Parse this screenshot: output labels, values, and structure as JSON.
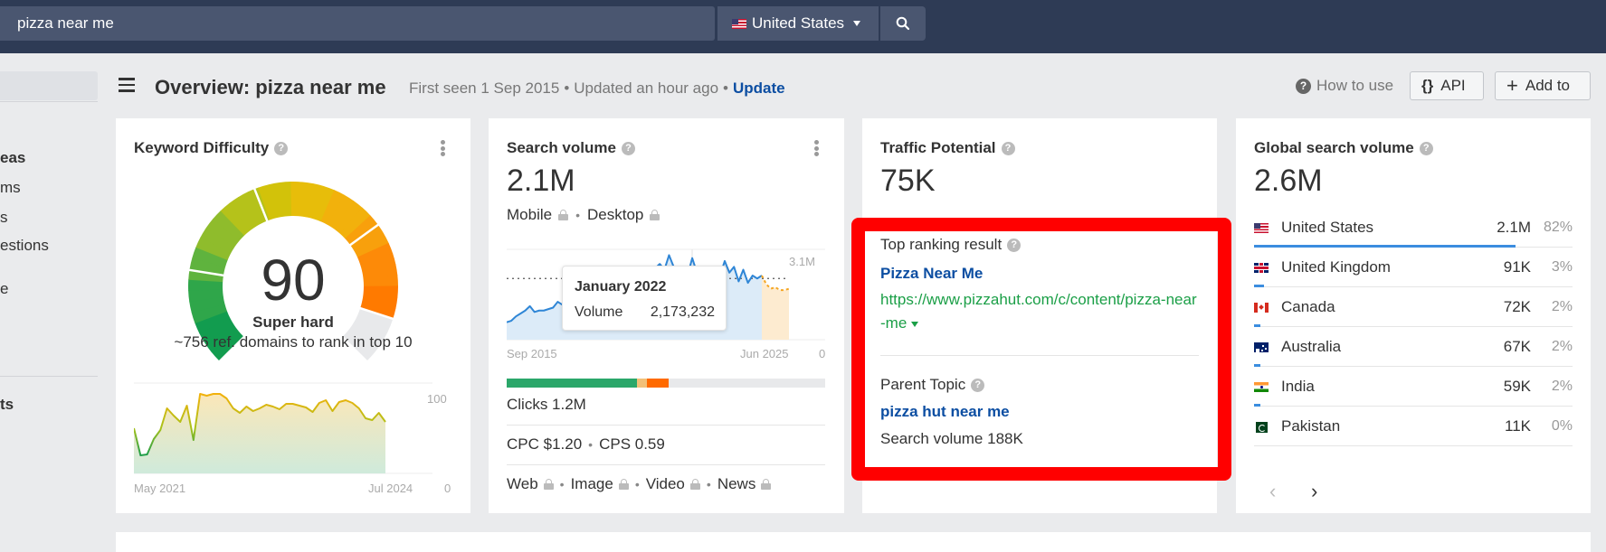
{
  "header": {
    "search_value": "pizza near me",
    "country": "United States",
    "country_flag": "us-flag-icon",
    "search_icon": "search-icon"
  },
  "sidebar": {
    "items": [
      {
        "label": "eas",
        "bold": true
      },
      {
        "label": "ms",
        "bold": false
      },
      {
        "label": "s",
        "bold": false
      },
      {
        "label": "estions",
        "bold": false
      },
      {
        "label": "e",
        "bold": false
      },
      {
        "label": "ts",
        "bold": true
      }
    ]
  },
  "title_row": {
    "title": "Overview: pizza near me",
    "first_seen": "First seen 1 Sep 2015",
    "updated": "Updated an hour ago",
    "update_link": "Update",
    "separator": "•",
    "how_to_use": "How to use",
    "api_label": "API",
    "add_to_label": "Add to"
  },
  "keyword_difficulty": {
    "title": "Keyword Difficulty",
    "score": "90",
    "score_value": 90,
    "label": "Super hard",
    "description": "~756 ref. domains to rank in top 10",
    "chart": {
      "start_label": "May 2021",
      "end_label": "Jul 2024",
      "y_max_label": "100",
      "y_min_label": "0",
      "values": [
        50,
        20,
        21,
        38,
        48,
        72,
        64,
        57,
        75,
        37,
        88,
        86,
        88,
        88,
        83,
        72,
        67,
        74,
        69,
        72,
        76,
        74,
        71,
        77,
        77,
        75,
        73,
        68,
        78,
        81,
        69,
        79,
        81,
        78,
        72,
        61,
        59,
        67,
        57
      ]
    }
  },
  "search_volume": {
    "title": "Search volume",
    "value": "2.1M",
    "mobile_label": "Mobile",
    "desktop_label": "Desktop",
    "chart": {
      "start_label": "Sep 2015",
      "end_label": "Jun 2025",
      "y_max_label": "3.1M",
      "y_min_label": "0",
      "average_line": 2.1,
      "values_millions": [
        0.6,
        0.65,
        0.8,
        0.9,
        1.0,
        1.15,
        0.95,
        1.0,
        1.0,
        1.05,
        1.1,
        1.3,
        1.2,
        1.4,
        1.7,
        1.8,
        1.75,
        1.85,
        1.95,
        1.9,
        2.0,
        1.9,
        2.1,
        2.0,
        2.3,
        2.15,
        2.2,
        2.4,
        2.3,
        2.5,
        2.2,
        2.3,
        2.45,
        2.6,
        2.4,
        2.9,
        2.5,
        2.4,
        2.3,
        2.2,
        2.8,
        2.3,
        2.5,
        2.2,
        2.4,
        2.3,
        2.2,
        2.7,
        2.3,
        2.5,
        2.0,
        2.4,
        1.95,
        2.2,
        2.1,
        2.2
      ],
      "forecast_millions": [
        2.2,
        1.9,
        1.75,
        1.8,
        1.7,
        1.7,
        1.75
      ]
    },
    "tooltip": {
      "title": "January 2022",
      "key": "Volume",
      "value": "2,173,232"
    },
    "clicks_bar": {
      "organic_pct": 41,
      "paid_light_pct": 3,
      "paid_pct": 7,
      "colors": {
        "organic": "#2ba76a",
        "paid_light": "#f2c078",
        "paid": "#ff6a00"
      }
    },
    "clicks": "Clicks 1.2M",
    "cpc": "CPC $1.20",
    "cps": "CPS 0.59",
    "serp_types": [
      "Web",
      "Image",
      "Video",
      "News"
    ]
  },
  "traffic_potential": {
    "title": "Traffic Potential",
    "value": "75K",
    "top_ranking_label": "Top ranking result",
    "top_ranking_title": "Pizza Near Me",
    "top_ranking_url": "https://www.pizzahut.com/c/content/pizza-near-me",
    "parent_topic_label": "Parent Topic",
    "parent_topic": "pizza hut near me",
    "parent_search_volume": "Search volume 188K",
    "highlight_color": "#ff0000"
  },
  "global_search_volume": {
    "title": "Global search volume",
    "value": "2.6M",
    "countries": [
      {
        "name": "United States",
        "volume": "2.1M",
        "pct": "82%",
        "share": 82,
        "flag": "us"
      },
      {
        "name": "United Kingdom",
        "volume": "91K",
        "pct": "3%",
        "share": 3,
        "flag": "uk"
      },
      {
        "name": "Canada",
        "volume": "72K",
        "pct": "2%",
        "share": 2,
        "flag": "ca"
      },
      {
        "name": "Australia",
        "volume": "67K",
        "pct": "2%",
        "share": 2,
        "flag": "au"
      },
      {
        "name": "India",
        "volume": "59K",
        "pct": "2%",
        "share": 2,
        "flag": "in"
      },
      {
        "name": "Pakistan",
        "volume": "11K",
        "pct": "0%",
        "share": 0,
        "flag": "pk"
      }
    ],
    "prev_icon": "chevron-left-icon",
    "next_icon": "chevron-right-icon"
  },
  "colors": {
    "topbar": "#2e3b55",
    "link_blue": "#0c4ea2",
    "url_green": "#1b9f47",
    "chart_blue": "#2f86d6",
    "forecast_orange": "#f5a623"
  }
}
